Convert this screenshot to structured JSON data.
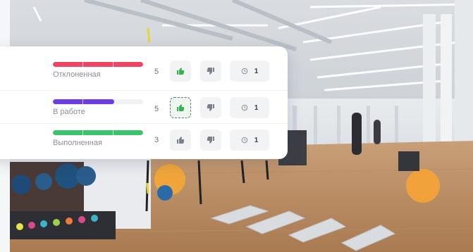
{
  "card": {
    "rows": [
      {
        "status": "Отклоненная",
        "count": "5",
        "timer_value": "1",
        "bar_color": "#ee4466",
        "progress": 1.0,
        "like_active": false,
        "like_color": "#37b24d",
        "dislike_color": "#7a7f89"
      },
      {
        "status": "В работе",
        "count": "5",
        "timer_value": "1",
        "bar_color": "#6c3de0",
        "progress": 0.68,
        "like_active": true,
        "like_color": "#37b24d",
        "dislike_color": "#7a7f89"
      },
      {
        "status": "Выполненная",
        "count": "3",
        "timer_value": "1",
        "bar_color": "#3cc46d",
        "progress": 1.0,
        "like_active": false,
        "like_color": "#7a7f89",
        "dislike_color": "#7a7f89"
      }
    ]
  },
  "icons": {
    "like": "thumbs-up-icon",
    "dislike": "thumbs-down-icon",
    "timer": "clock-icon"
  }
}
